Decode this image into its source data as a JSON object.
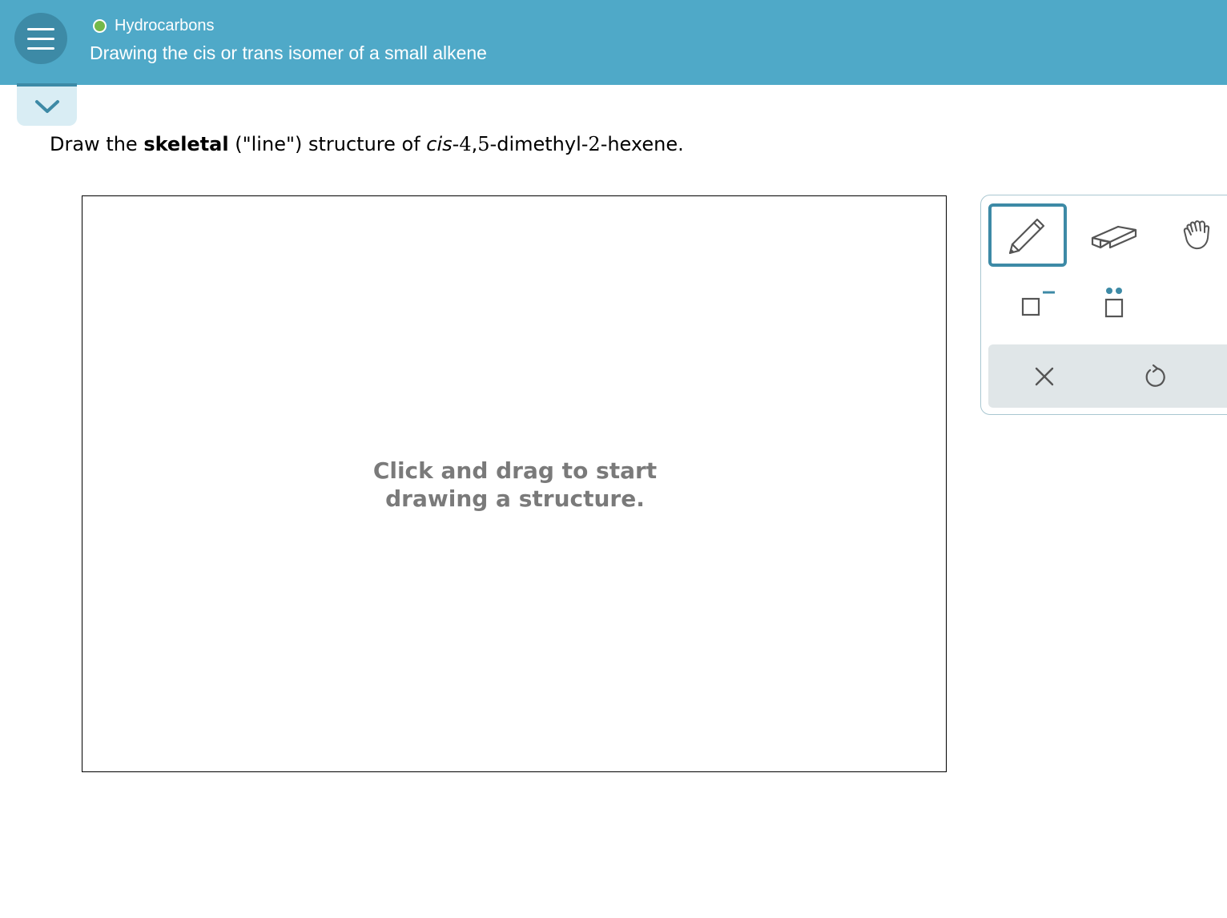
{
  "header": {
    "topic": "Hydrocarbons",
    "title": "Drawing the cis or trans isomer of a small alkene",
    "status_color": "#74b94a",
    "background_color": "#4fa9c8"
  },
  "question": {
    "prefix": "Draw the ",
    "bold": "skeletal",
    "middle": " (\"line\") structure of ",
    "italic": "cis",
    "dash1": "-",
    "num1": "4",
    "comma": ",",
    "num2": "5",
    "part3": "-dimethyl-",
    "num3": "2",
    "suffix": "-hexene."
  },
  "canvas": {
    "placeholder": "Click and drag to start drawing a structure."
  },
  "toolbar": {
    "tools": [
      "pencil-icon",
      "eraser-icon",
      "hand-icon",
      "negative-charge-icon",
      "lone-pair-icon"
    ],
    "selected_tool": "pencil-icon",
    "actions": [
      "clear-icon",
      "undo-icon"
    ],
    "accent_color": "#3d8aa6"
  }
}
